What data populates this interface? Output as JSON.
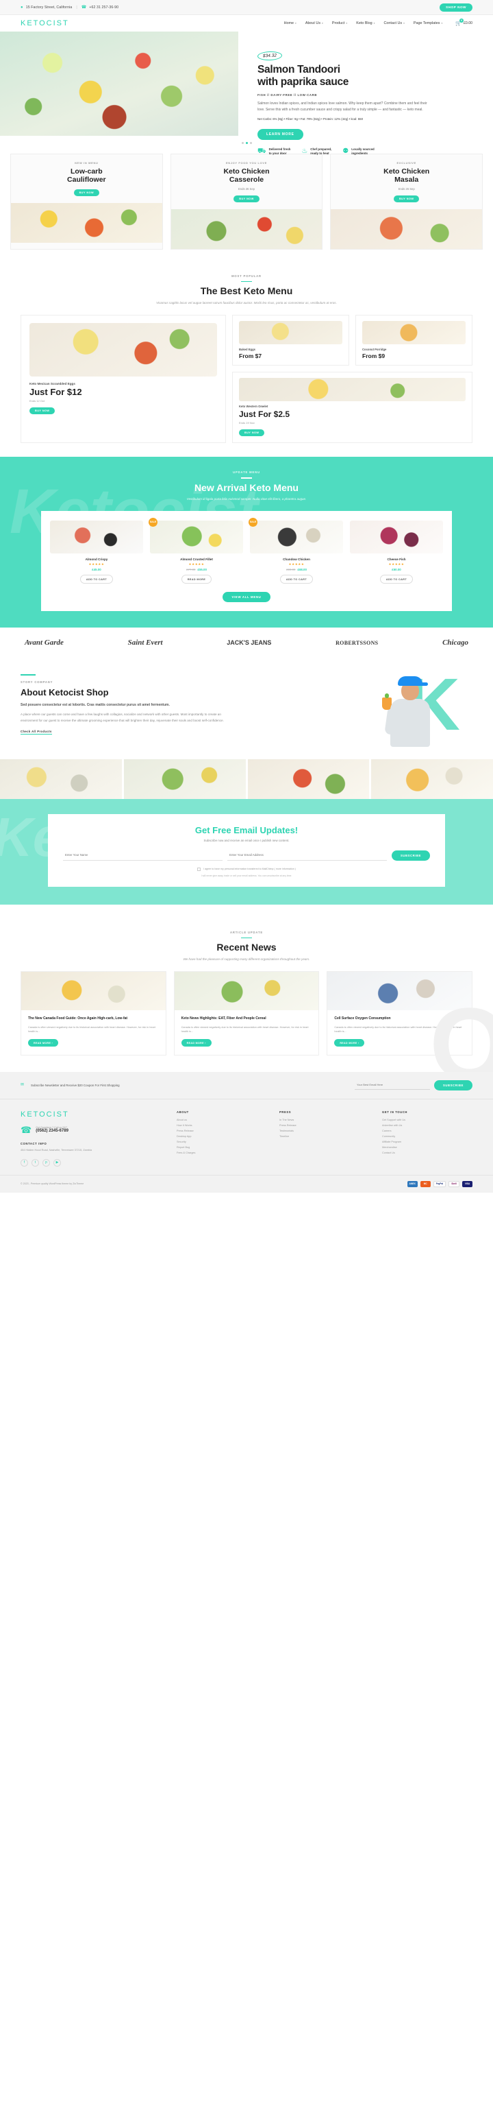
{
  "topbar": {
    "address": "15 Factory Street, California",
    "phone": "+62 31 257-36-90",
    "separator": "|",
    "shop_now": "SHOP NOW",
    "location_icon": "map-pin-icon",
    "phone_icon": "phone-icon"
  },
  "nav": {
    "logo": "KETOCIST",
    "items": [
      {
        "label": "Home",
        "caret": "▾"
      },
      {
        "label": "About Us",
        "caret": "▾"
      },
      {
        "label": "Product",
        "caret": "▾"
      },
      {
        "label": "Keto Blog",
        "caret": "▾"
      },
      {
        "label": "Contact Us",
        "caret": "▾"
      },
      {
        "label": "Page Templates",
        "caret": "▾"
      }
    ],
    "cart": {
      "icon": "shopping-cart-icon",
      "count": "0",
      "amount": "£0.00"
    }
  },
  "hero": {
    "price": "$34.32",
    "title_line1": "Salmon Tandoori",
    "title_line2": "with paprika sauce",
    "tags": "FISH // DAIRY-FREE // LOW-CARB",
    "paragraph": "Salmon loves Indian spices, and Indian spices love salmon. Why keep them apart? Combine them and feel their love. Serve this with a fresh cucumber sauce and crispy salad for a truly simple — and fantastic — keto meal.",
    "nutrition": "Net Carbs: 6% (8g) • Fiber: 9g • Fat: 79% (62g) • Protein: 12% (42g) • kcal: 550",
    "cta": "LEARN MORE",
    "features": [
      {
        "icon": "delivery-truck-icon",
        "glyph": "⛟",
        "line1": "Delivered fresh",
        "line2": "to your door"
      },
      {
        "icon": "flame-icon",
        "glyph": "♨",
        "line1": "Chef prepared,",
        "line2": "ready to heat"
      },
      {
        "icon": "map-pin-icon",
        "glyph": "⚉",
        "line1": "Locally sourced",
        "line2": "ingredients"
      }
    ],
    "slider_dots": 3,
    "active_dot": 1
  },
  "promos": [
    {
      "kicker": "NEW IN MENU",
      "title_l1": "Low-carb",
      "title_l2": "Cauliflower",
      "ends": "",
      "button": "BUY NOW"
    },
    {
      "kicker": "ENJOY FOOD YOU LOVE",
      "title_l1": "Keto Chicken",
      "title_l2": "Casserole",
      "ends": "Ends 26 Sep",
      "button": "BUY NOW"
    },
    {
      "kicker": "EXCLUSIVE",
      "title_l1": "Keto Chicken",
      "title_l2": "Masala",
      "ends": "Ends 26 Sep",
      "button": "BUY NOW"
    }
  ],
  "best_menu": {
    "kicker": "MOST POPULAR",
    "title": "The Best Keto Menu",
    "subtitle": "Vivamus sagittis lacus vel augue laoreet rutrum faucibus dolor auctor. Morbi leo risus, porta ac consectetur ac, vestibulum at eros.",
    "featured": {
      "name": "Keto Mexican Scrambled Eggs",
      "price": "Just For $12",
      "ends": "Ends 12 Oct",
      "button": "BUY NOW"
    },
    "cards": [
      {
        "name": "Baked Eggs",
        "price": "From $7"
      },
      {
        "name": "Coconut Porridge",
        "price": "From $9"
      }
    ],
    "wide_card": {
      "name": "Keto Western Omelet",
      "price": "Just For $2.5",
      "ends": "Ends 19 Nov",
      "button": "BUY NOW"
    }
  },
  "new_arrival": {
    "kicker": "UPDATE MENU",
    "title": "New Arrival Keto Menu",
    "subtitle": "Vestibulum id ligula porta felis euismod semper. Nulla vitae elit libero, a pharetra augue.",
    "products": [
      {
        "badge": "",
        "name": "Almond Crispy",
        "stars": "★★★★★",
        "old_price": "",
        "price": "£45.00",
        "button": "ADD TO CART"
      },
      {
        "badge": "SALE",
        "name": "Almond Crusted Fillet",
        "stars": "★★★★★",
        "old_price": "£77.00",
        "price": "£55.00",
        "button": "READ MORE"
      },
      {
        "badge": "SALE",
        "name": "Chandow Chicken",
        "stars": "★★★★★",
        "old_price": "£90.00",
        "price": "£68.00",
        "button": "ADD TO CART"
      },
      {
        "badge": "",
        "name": "Cheese Fish",
        "stars": "★★★★★",
        "old_price": "",
        "price": "£50.00",
        "button": "ADD TO CART"
      }
    ],
    "view_all": "VIEW ALL MENU"
  },
  "brands": [
    {
      "name": "Avant Garde",
      "style": "script"
    },
    {
      "name": "Saint Evert",
      "style": "script"
    },
    {
      "name": "JACK'S JEANS",
      "style": "bold"
    },
    {
      "name": "ROBERTSSONS",
      "style": "serif"
    },
    {
      "name": "Chicago",
      "style": "script"
    }
  ],
  "about": {
    "kicker": "STORY COMPANY",
    "title": "About Ketocist Shop",
    "lead": "Sed posuere consectetur est at lobortis. Cras mattis consectetur purus sit amet fermentum.",
    "paragraph": "A place where our guests can come and have a few laughs with collagios, socialize and network with other guests. Most importantly to create an environment for our guest to receive the ultimate grooming experience that will brighten their day, rejuvenate their souls and boost self-confidence.",
    "link": "Check All Products"
  },
  "newsletter": {
    "title": "Get Free Email Updates!",
    "subtitle": "Subscribe now and receive an email once I publish new content.",
    "name_placeholder": "Enter Your Name",
    "email_placeholder": "Enter Your Email Address",
    "button": "SUBSCRIBE",
    "consent": "I agree to have my personal information transfered to MailChimp ( more information )",
    "fine_print": "I will never give away, trade or sell your email address. You can unsubscribe at any time."
  },
  "recent_news": {
    "kicker": "ARTICLE UPDATE",
    "title": "Recent News",
    "subtitle": "We have had the pleasure of supporting many different organizations throughout the years.",
    "posts": [
      {
        "title": "The New Canada Food Guide: Once Again High-carb, Low-fat",
        "excerpt": "Canada is often viewed negatively due to its historical association with heart disease. However, for risk in heart health is...",
        "button": "READ MORE ›"
      },
      {
        "title": "Keto News Highlights: EAT, Fiber And People Cereal",
        "excerpt": "Canada is often viewed negatively due to its historical association with heart disease. However, for risk in heart health is...",
        "button": "READ MORE ›"
      },
      {
        "title": "Cell Surface Oxygen Consumption",
        "excerpt": "Canada is often viewed negatively due to its historical association with heart disease. However, for risk in heart health is...",
        "button": "READ MORE ›"
      }
    ]
  },
  "footer": {
    "subscribe_label": "Subscribe Newsletter and Receive $20 Coupon For First Shopping",
    "subscribe_placeholder": "Your Best Email Here",
    "subscribe_button": "SUBSCRIBE",
    "logo": "KETOCIST",
    "question_label": "Got Questions ? Call us 24/7",
    "phone": "(0562) 2345-6789",
    "headset_icon": "headset-icon",
    "contact_info_heading": "CONTACT INFO",
    "address": "454 Hidden Hood Road, Nashville, Tennessee 37215, Zambia",
    "socials": [
      {
        "icon": "facebook-icon",
        "glyph": "f"
      },
      {
        "icon": "twitter-icon",
        "glyph": "t"
      },
      {
        "icon": "pinterest-icon",
        "glyph": "p"
      },
      {
        "icon": "youtube-icon",
        "glyph": "▶"
      }
    ],
    "columns": [
      {
        "heading": "ABOUT",
        "links": [
          "About us",
          "How It Works",
          "Press Release",
          "Desktop App",
          "Security",
          "Report Bug",
          "Fees & Charges"
        ]
      },
      {
        "heading": "PRESS",
        "links": [
          "In The News",
          "Press Release",
          "Testimonials",
          "Timeline"
        ]
      },
      {
        "heading": "GET IN TOUCH",
        "links": [
          "Get Support with Us",
          "Advertise with Us",
          "Careers",
          "Community",
          "Affiliate Program",
          "Merchandise",
          "Contact Us"
        ]
      }
    ],
    "copyright": "© 2023 - Premium quality WordPress theme by ZioTheme",
    "payments": [
      {
        "name": "AMEX",
        "bg": "#2e77bc"
      },
      {
        "name": "MC",
        "bg": "#eb5d1e"
      },
      {
        "name": "PayPal",
        "bg": "#ffffff"
      },
      {
        "name": "Skrill",
        "bg": "#ffffff"
      },
      {
        "name": "VISA",
        "bg": "#1a1f71"
      }
    ]
  },
  "colors": {
    "accent": "#2ed4b2",
    "teal_band": "#4fdcc0",
    "orange_badge": "#f6a623",
    "star": "#f6a623"
  }
}
